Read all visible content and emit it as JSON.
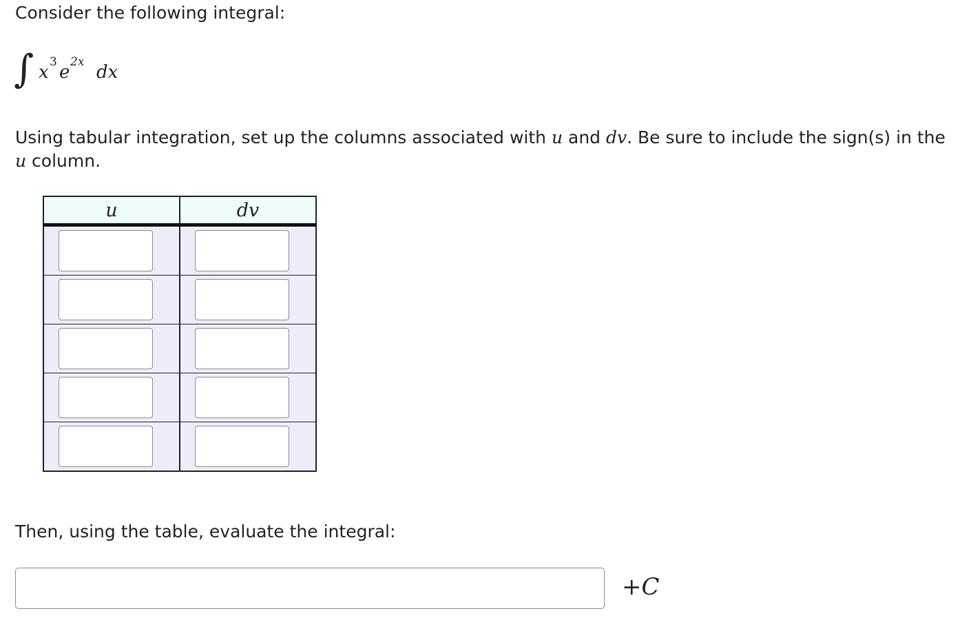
{
  "prompt": {
    "intro": "Consider the following integral:",
    "integral": {
      "sign": "∫",
      "var": "x",
      "var_exponent": "3",
      "base": "e",
      "base_exponent": "2x",
      "differential": "dx"
    },
    "instructions": {
      "part1": "Using tabular integration, set up the columns associated with ",
      "u": "u",
      "part2": " and ",
      "dv": "dv",
      "part3": ". Be sure to include the sign(s) in the ",
      "u2": "u",
      "part4": " column."
    }
  },
  "table": {
    "headers": [
      "u",
      "dv"
    ],
    "rows": [
      {
        "u": "",
        "dv": ""
      },
      {
        "u": "",
        "dv": ""
      },
      {
        "u": "",
        "dv": ""
      },
      {
        "u": "",
        "dv": ""
      },
      {
        "u": "",
        "dv": ""
      }
    ]
  },
  "evaluate": {
    "text": "Then, using the table, evaluate the integral:",
    "answer_value": "",
    "constant_plus": "+",
    "constant_letter": "C"
  }
}
